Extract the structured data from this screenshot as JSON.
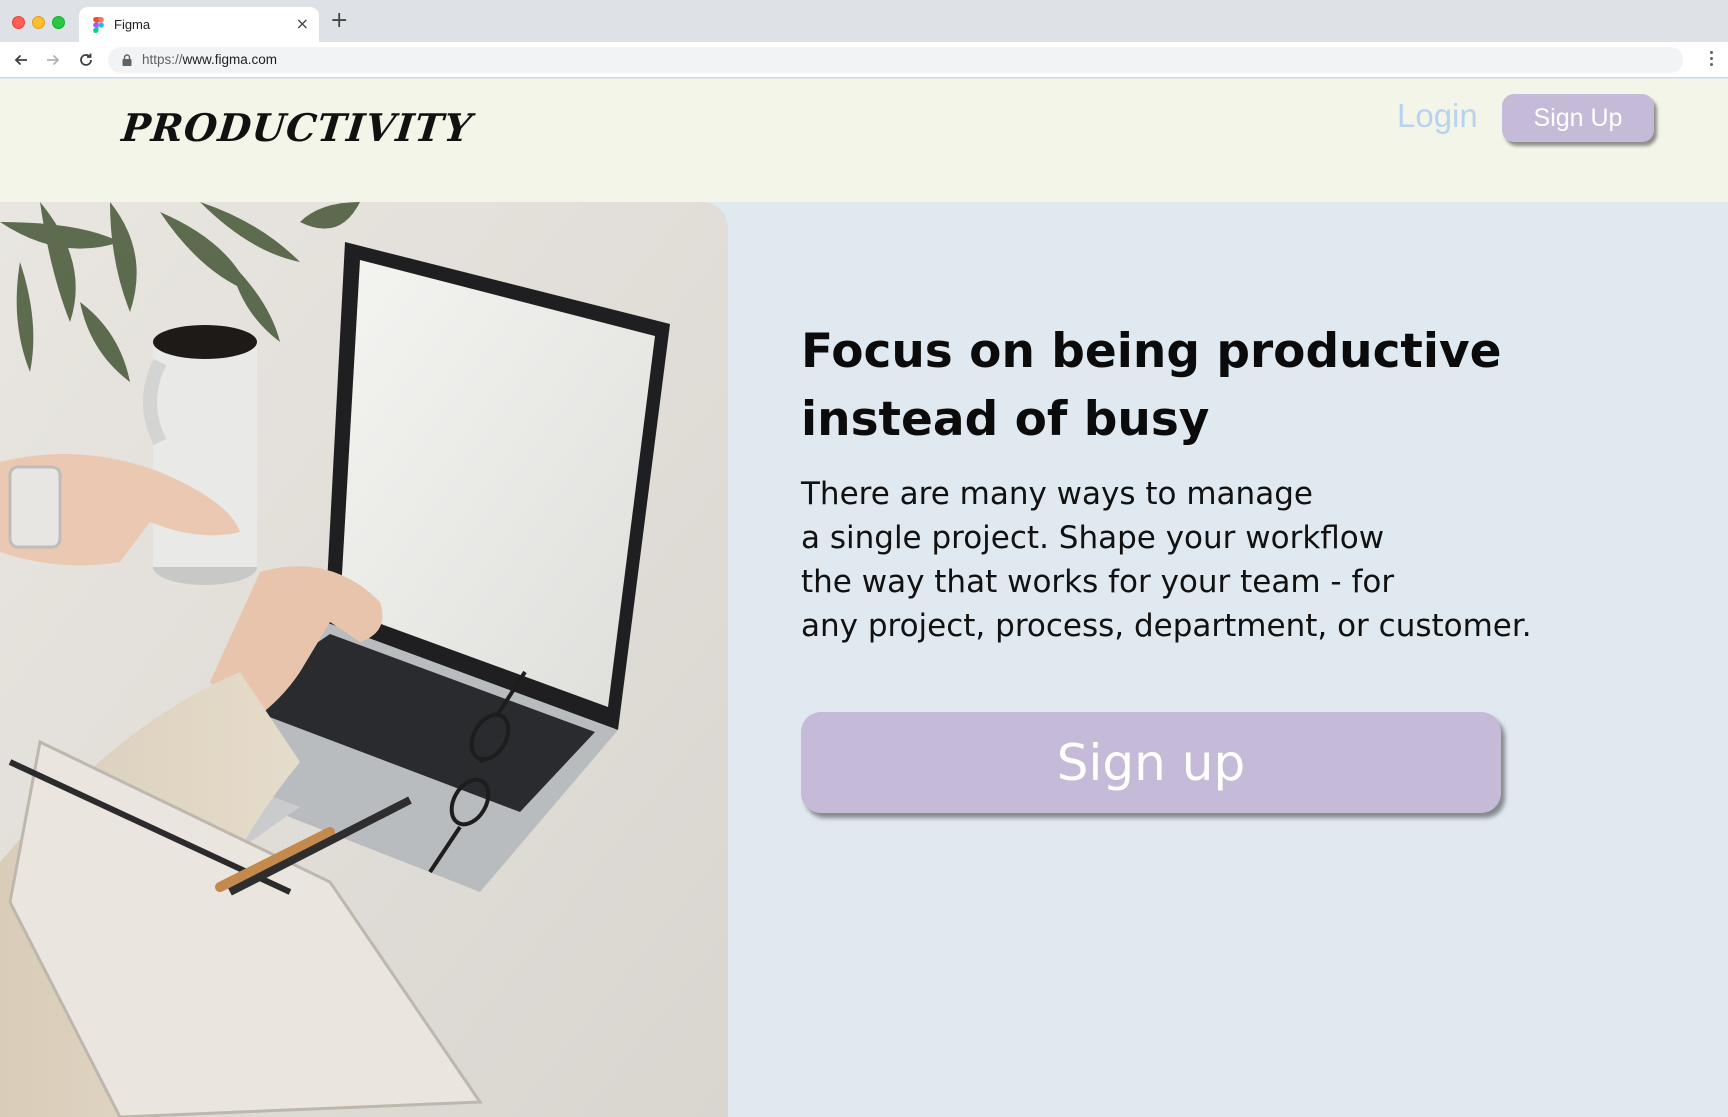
{
  "browser": {
    "tab_title": "Figma",
    "tab_close": "×",
    "new_tab": "+",
    "url_scheme": "https://",
    "url_host": "www.figma.com"
  },
  "site": {
    "logo": "PRODUCTIVITY",
    "login_label": "Login",
    "signup_small_label": "Sign Up"
  },
  "hero": {
    "headline_lines": [
      "Focus on being productive",
      "instead of busy"
    ],
    "body_lines": [
      "There are many ways to manage",
      "a single project. Shape your workflow",
      "the way that works for your team - for",
      "any project, process, department, or customer."
    ],
    "cta_label": "Sign up",
    "image_icon": "laptop-workspace-photo"
  },
  "colors": {
    "header_bg": "#f3f5e9",
    "hero_bg": "#dfe9ef",
    "button": "#c5bad8",
    "login_link": "#b9d3ee"
  }
}
